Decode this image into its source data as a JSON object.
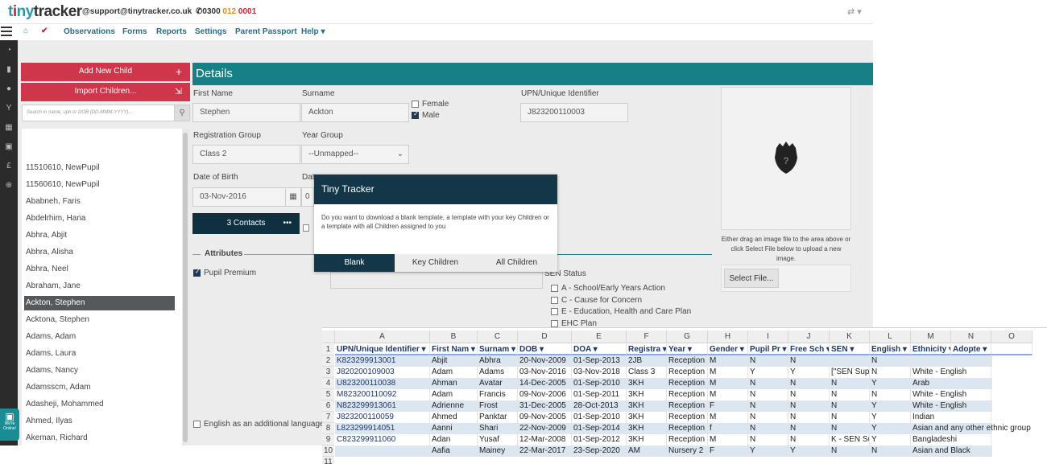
{
  "header": {
    "email": "@support@tinytracker.co.uk",
    "phone_a": "0300 ",
    "phone_b": "012 ",
    "phone_c": "0001"
  },
  "logo": {
    "t1": "t",
    "i": "i",
    "rest": "ny",
    "tracker": "tracker"
  },
  "nav": [
    "Observations",
    "Forms",
    "Reports",
    "Settings",
    "Parent Passport",
    "Help ▾"
  ],
  "sidebar": {
    "add_label": "Add New Child",
    "import_label": "Import Children...",
    "search_placeholder": "Search in name, upn or DOB (DD-MMM-YYYY)...",
    "children": [
      "11510610, NewPupil",
      "11560610, NewPupil",
      "Ababneh, Faris",
      "Abdelrhim, Hana",
      "Abhra, Abjit",
      "Abhra, Alisha",
      "Abhra, Neel",
      "Abraham, Jane",
      "Ackton, Stephen",
      "Acktona, Stephen",
      "Adams, Adam",
      "Adams, Laura",
      "Adams, Nancy",
      "Adamsscm, Adam",
      "Adasheji, Mohammed",
      "Ahmed, Ilyas",
      "Akeman, Richard"
    ],
    "selected_index": 8
  },
  "details": {
    "heading": "Details",
    "first_name_label": "First Name",
    "first_name": "Stephen",
    "surname_label": "Surname",
    "surname": "Ackton",
    "female_label": "Female",
    "male_label": "Male",
    "upn_label": "UPN/Unique Identifier",
    "upn": "J823200110003",
    "reg_group_label": "Registration Group",
    "reg_group": "Class 2",
    "year_group_label": "Year Group",
    "year_group": "--Unmapped--",
    "dob_label": "Date of Birth",
    "dob": "03-Nov-2016",
    "doa_label_partial": "Dat",
    "doa_partial": "0",
    "contacts_label": "3 Contacts",
    "contacts_more": "•••",
    "attributes_label": "Attributes",
    "pupil_premium_label": "Pupil Premium",
    "eal_label": "English as an additional language",
    "sen_status_label": "SEN Status",
    "sen_options": [
      "A - School/Early Years Action",
      "C - Cause for Concern",
      "E - Education, Health and Care Plan",
      "EHC Plan"
    ],
    "photo_hint": "Either drag an image file to the area above or click Select File below to upload a new image.",
    "select_file_label": "Select File..."
  },
  "modal": {
    "title": "Tiny Tracker",
    "body": "Do you want to download a blank template, a template with your key Children or a template with all Children assigned to you",
    "buttons": [
      "Blank",
      "Key Children",
      "All Children"
    ]
  },
  "chat": {
    "line1": "We're",
    "line2": "Online!"
  },
  "sheet": {
    "col_letters": [
      "A",
      "B",
      "C",
      "D",
      "E",
      "F",
      "G",
      "H",
      "I",
      "J",
      "K",
      "L",
      "M",
      "N",
      "O"
    ],
    "headers": [
      "UPN/Unique Identifier ▾",
      "First Nam ▾",
      "Surnam ▾",
      "DOB ▾",
      "DOA ▾",
      "Registra ▾",
      "Year ▾",
      "Gender ▾",
      "Pupil Pr ▾",
      "Free Sch ▾",
      "SEN ▾",
      "English ▾",
      "Ethnicity ▾",
      "Adopte ▾",
      ""
    ],
    "row_numbers": [
      "1",
      "2",
      "3",
      "4",
      "5",
      "6",
      "7",
      "8",
      "9",
      "10",
      "11"
    ],
    "rows": [
      [
        "K823299913001",
        "Abjit",
        "Abhra",
        "20-Nov-2009",
        "01-Sep-2013",
        "2JB",
        "Reception",
        "M",
        "N",
        "N",
        "",
        "N",
        "",
        ""
      ],
      [
        "J820200109003",
        "Adam",
        "Adams",
        "03-Nov-2016",
        "03-Nov-2018",
        "Class 3",
        "Reception",
        "M",
        "Y",
        "Y",
        "[\"SEN Supp",
        "N",
        "White - English",
        ""
      ],
      [
        "U823200110038",
        "Ahman",
        "Avatar",
        "14-Dec-2005",
        "01-Sep-2010",
        "3KH",
        "Reception",
        "M",
        "N",
        "N",
        "N",
        "Y",
        "Arab",
        ""
      ],
      [
        "M823200110092",
        "Adam",
        "Francis",
        "09-Nov-2006",
        "01-Sep-2011",
        "3KH",
        "Reception",
        "M",
        "N",
        "N",
        "N",
        "N",
        "White - English",
        ""
      ],
      [
        "N823299913061",
        "Adrienne",
        "Frost",
        "31-Dec-2005",
        "28-Oct-2013",
        "3KH",
        "Reception",
        "F",
        "N",
        "N",
        "N",
        "Y",
        "White - English",
        ""
      ],
      [
        "J823200110059",
        "Ahmed",
        "Panktar",
        "09-Nov-2005",
        "01-Sep-2010",
        "3KH",
        "Reception",
        "M",
        "N",
        "N",
        "N",
        "Y",
        "Indian",
        ""
      ],
      [
        "L823299914051",
        "Aanni",
        "Shari",
        "22-Nov-2009",
        "01-Sep-2014",
        "3KH",
        "Reception",
        "f",
        "N",
        "N",
        "N",
        "Y",
        "Asian and any other ethnic group",
        ""
      ],
      [
        "C823299911060",
        "Adan",
        "Yusaf",
        "12-Mar-2008",
        "01-Sep-2012",
        "3KH",
        "Reception",
        "M",
        "N",
        "N",
        "K - SEN Sup",
        "Y",
        "Bangladeshi",
        ""
      ],
      [
        "",
        "Aafia",
        "Mainey",
        "22-Mar-2017",
        "23-Sep-2020",
        "AM",
        "Nursery 2",
        "F",
        "Y",
        "Y",
        "N",
        "N",
        "Asian and Black",
        ""
      ]
    ]
  }
}
